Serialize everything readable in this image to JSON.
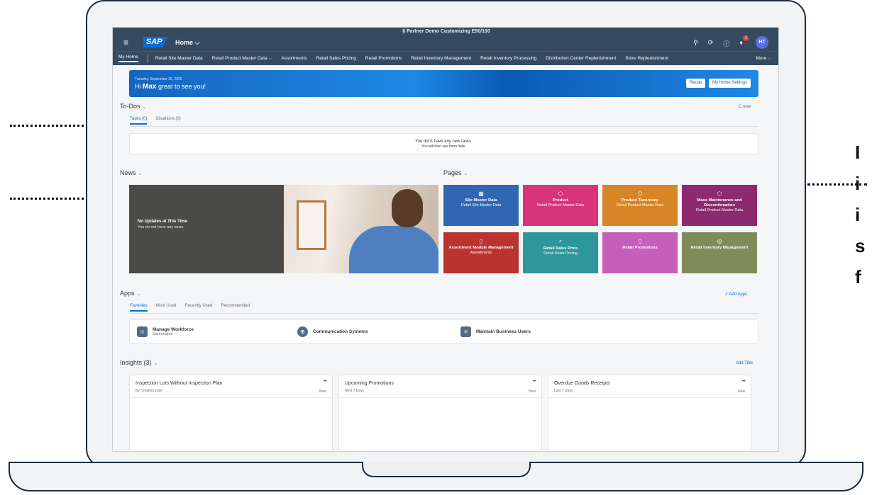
{
  "shell": {
    "system": "§ Partner Demo Customizing  E90/100",
    "logo": "SAP",
    "home_label": "Home ⌵",
    "notification_count": "1",
    "avatar_initials": "HT"
  },
  "nav": {
    "items": [
      {
        "label": "My Home"
      },
      {
        "label": "Retail Site Master Data"
      },
      {
        "label": "Retail Product Master Data ⌵"
      },
      {
        "label": "Assortments"
      },
      {
        "label": "Retail Sales Pricing"
      },
      {
        "label": "Retail Promotions"
      },
      {
        "label": "Retail Inventory Management"
      },
      {
        "label": "Retail Inventory Processing"
      },
      {
        "label": "Distribution Center Replenishment"
      },
      {
        "label": "Store Replenishment"
      }
    ],
    "more": "More ⌵"
  },
  "banner": {
    "date": "Tuesday, September 30, 2025",
    "greeting_prefix": "Hi",
    "user": "Max",
    "greeting_suffix": "great to see you!",
    "recap": "Recap",
    "settings": "My Home Settings"
  },
  "todos": {
    "title": "To-Dos",
    "refresh": "C now",
    "tabs": [
      "Tasks (0)",
      "Situations (0)"
    ],
    "empty_line1": "You don't have any new tasks.",
    "empty_line2": "You will then see them here."
  },
  "news": {
    "title": "News",
    "headline": "No Updates at This Time",
    "subline": "You do not have any news."
  },
  "pages": {
    "title": "Pages",
    "tiles": [
      {
        "title": "Site Master Data",
        "subtitle": "Retail Site Master Data",
        "color": "#3167b2",
        "icon": "grid-icon",
        "glyph": "▦"
      },
      {
        "title": "Product",
        "subtitle": "Retail Product Master Data",
        "color": "#d8347a",
        "icon": "cube-icon",
        "glyph": "⬡"
      },
      {
        "title": "Product Taxonomy",
        "subtitle": "Retail Product Master Data",
        "color": "#d88525",
        "icon": "cube-icon",
        "glyph": "⬡"
      },
      {
        "title": "Mass Maintenance and Discontinuation",
        "subtitle": "Retail Product Master Data",
        "color": "#8b2a6e",
        "icon": "cube-icon",
        "glyph": "⬡"
      },
      {
        "title": "Assortment Module Management",
        "subtitle": "Assortments",
        "color": "#b9332f",
        "icon": "document-icon",
        "glyph": "▯"
      },
      {
        "title": "Retail Sales Price",
        "subtitle": "Retail Sales Pricing",
        "color": "#2e979b",
        "icon": "search-icon",
        "glyph": "⌕"
      },
      {
        "title": "Retail Promotions",
        "subtitle": "",
        "color": "#c55fba",
        "icon": "document-icon",
        "glyph": "▯"
      },
      {
        "title": "Retail Inventory Management",
        "subtitle": "",
        "color": "#7f8c5a",
        "icon": "target-icon",
        "glyph": "◎"
      }
    ]
  },
  "apps": {
    "title": "Apps",
    "add": "Add Apps",
    "tabs": [
      "Favorites",
      "Most Used",
      "Recently Used",
      "Recommended"
    ],
    "items": [
      {
        "name": "Manage Workforce",
        "sub": "Deprecated",
        "icon": "person-icon",
        "glyph": "☺"
      },
      {
        "name": "Communication Systems",
        "sub": "",
        "icon": "globe-icon",
        "glyph": "⊕"
      },
      {
        "name": "Maintain Business Users",
        "sub": "",
        "icon": "users-icon",
        "glyph": "≡"
      }
    ]
  },
  "insights": {
    "title": "Insights (3)",
    "add": "Add Tiles",
    "cards": [
      {
        "title": "Inspection Lots Without Inspection Plan",
        "sub": "By Creation Date",
        "time": "Now"
      },
      {
        "title": "Upcoming Promotions",
        "sub": "Next 7 Days",
        "time": "Now"
      },
      {
        "title": "Overdue Goods Receipts",
        "sub": "Last 7 Days",
        "time": "Now"
      }
    ]
  },
  "side_text": [
    "I",
    "i",
    "i",
    "s",
    "f"
  ]
}
